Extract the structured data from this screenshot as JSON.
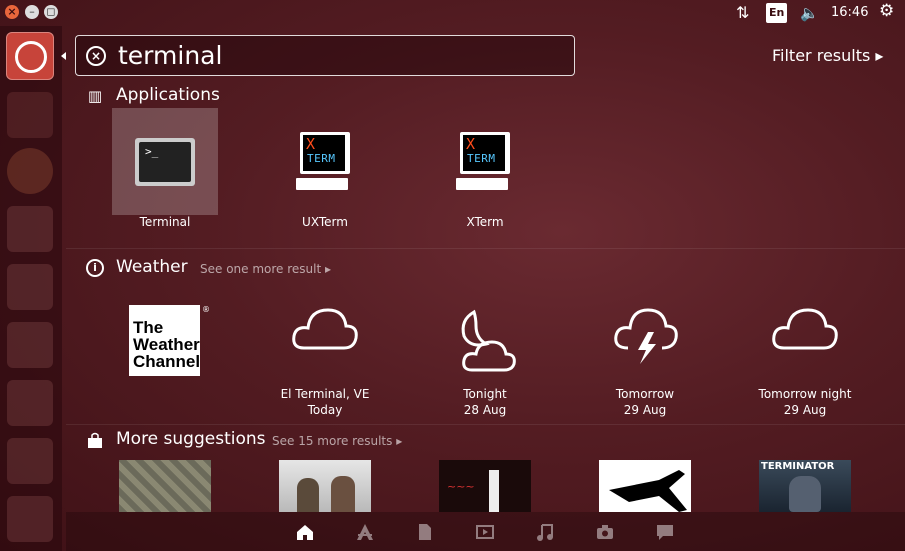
{
  "window_controls": {
    "close": "×",
    "minimize": "–",
    "maximize": "◻"
  },
  "indicators": {
    "network": "⇅",
    "keyboard": "En",
    "volume": "🔈",
    "time": "16:46",
    "settings": "⚙"
  },
  "launcher": {
    "items": [
      "ubuntu-logo-icon",
      "files-icon",
      "firefox-icon",
      "writer-icon",
      "calc-icon",
      "impress-icon",
      "software-center-icon",
      "amazon-icon",
      "more-icon"
    ]
  },
  "search": {
    "query": "terminal",
    "filter_label": "Filter results ▸"
  },
  "applications": {
    "title": "Applications",
    "items": [
      {
        "label": "Terminal",
        "icon": "terminal-icon"
      },
      {
        "label": "UXTerm",
        "icon": "xterm-icon"
      },
      {
        "label": "XTerm",
        "icon": "xterm-icon"
      }
    ],
    "xterm_x": "X",
    "xterm_t": "TERM",
    "terminal_prompt": ">_"
  },
  "weather": {
    "title": "Weather",
    "more": "See one more result ▸",
    "logo_text": "The Weather Channel",
    "logo_r": "®",
    "items": [
      {
        "line1": "El Terminal, VE",
        "line2": "Today",
        "icon": "cloud-icon"
      },
      {
        "line1": "Tonight",
        "line2": "28 Aug",
        "icon": "moon-cloud-icon"
      },
      {
        "line1": "Tomorrow",
        "line2": "29 Aug",
        "icon": "thunderstorm-icon"
      },
      {
        "line1": "Tomorrow night",
        "line2": "29 Aug",
        "icon": "cloud-icon"
      }
    ]
  },
  "suggestions": {
    "title": "More suggestions",
    "more": "See 15 more results ▸",
    "terminator_text": "TERMINATOR"
  },
  "bottom_bar": [
    "home-icon",
    "apps-icon",
    "files-icon",
    "video-icon",
    "music-icon",
    "photos-icon",
    "social-icon"
  ]
}
